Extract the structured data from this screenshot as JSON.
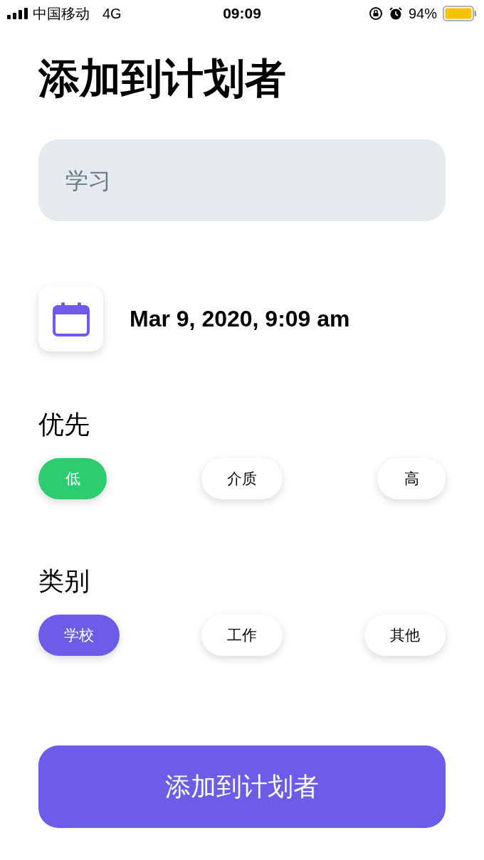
{
  "status_bar": {
    "carrier": "中国移动",
    "network": "4G",
    "time": "09:09",
    "battery": "94%"
  },
  "title": "添加到计划者",
  "task_field": {
    "placeholder": "学习"
  },
  "date": "Mar 9, 2020, 9:09 am",
  "priority": {
    "label": "优先",
    "options": [
      {
        "label": "低",
        "selected": true
      },
      {
        "label": "介质",
        "selected": false
      },
      {
        "label": "高",
        "selected": false
      }
    ]
  },
  "category": {
    "label": "类别",
    "options": [
      {
        "label": "学校",
        "selected": true
      },
      {
        "label": "工作",
        "selected": false
      },
      {
        "label": "其他",
        "selected": false
      }
    ]
  },
  "submit_button": "添加到计划者"
}
